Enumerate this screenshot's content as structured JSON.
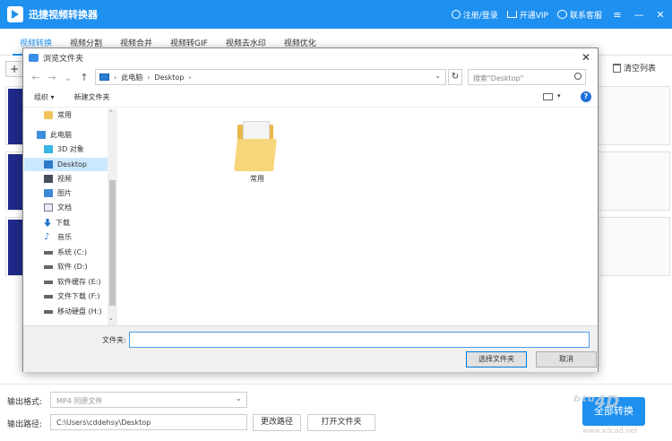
{
  "app": {
    "title": "迅捷视频转换器",
    "links": [
      "注册/登录",
      "开通VIP",
      "联系客服"
    ],
    "win_buttons": [
      "≡",
      "—",
      "✕"
    ]
  },
  "tabs": [
    "视频转换",
    "视频分割",
    "视频合并",
    "视频转GIF",
    "视频去水印",
    "视频优化"
  ],
  "toolbar": {
    "add_label": "+",
    "clear_list": "清空列表"
  },
  "bottom": {
    "format_label": "输出格式:",
    "format_value": "MP4  同原文件",
    "path_label": "输出路径:",
    "path_value": "C:\\Users\\cddehsy\\Desktop",
    "change_path": "更改路径",
    "open_folder": "打开文件夹",
    "convert_all": "全部转换"
  },
  "dialog": {
    "title": "浏览文件夹",
    "close": "✕",
    "address": [
      "此电脑",
      "Desktop"
    ],
    "search_placeholder": "搜索\"Desktop\"",
    "organize": "组织 ▾",
    "new_folder": "新建文件夹",
    "help": "?",
    "tree": [
      {
        "label": "常用",
        "icon": "folder"
      },
      {
        "label": "此电脑",
        "icon": "pc"
      },
      {
        "label": "3D 对象",
        "icon": "cube"
      },
      {
        "label": "Desktop",
        "icon": "blue"
      },
      {
        "label": "视频",
        "icon": "video"
      },
      {
        "label": "图片",
        "icon": "pic"
      },
      {
        "label": "文档",
        "icon": "doc"
      },
      {
        "label": "下载",
        "icon": "down"
      },
      {
        "label": "音乐",
        "icon": "music"
      },
      {
        "label": "系统 (C:)",
        "icon": "drive"
      },
      {
        "label": "软件 (D:)",
        "icon": "drive"
      },
      {
        "label": "软件缓存 (E:)",
        "icon": "drive"
      },
      {
        "label": "文件下载 (F:)",
        "icon": "drive"
      },
      {
        "label": "移动硬盘 (H:)",
        "icon": "drive"
      }
    ],
    "content_items": [
      "常用"
    ],
    "folder_label": "文件夹:",
    "folder_value": "",
    "select_button": "选择文件夹",
    "cancel_button": "取消"
  },
  "watermark": {
    "text": "ᵇᵗᵘ4D",
    "url": "www.xdcad.net"
  },
  "colors": {
    "accent": "#1e90f0",
    "selection": "#cce8ff"
  }
}
